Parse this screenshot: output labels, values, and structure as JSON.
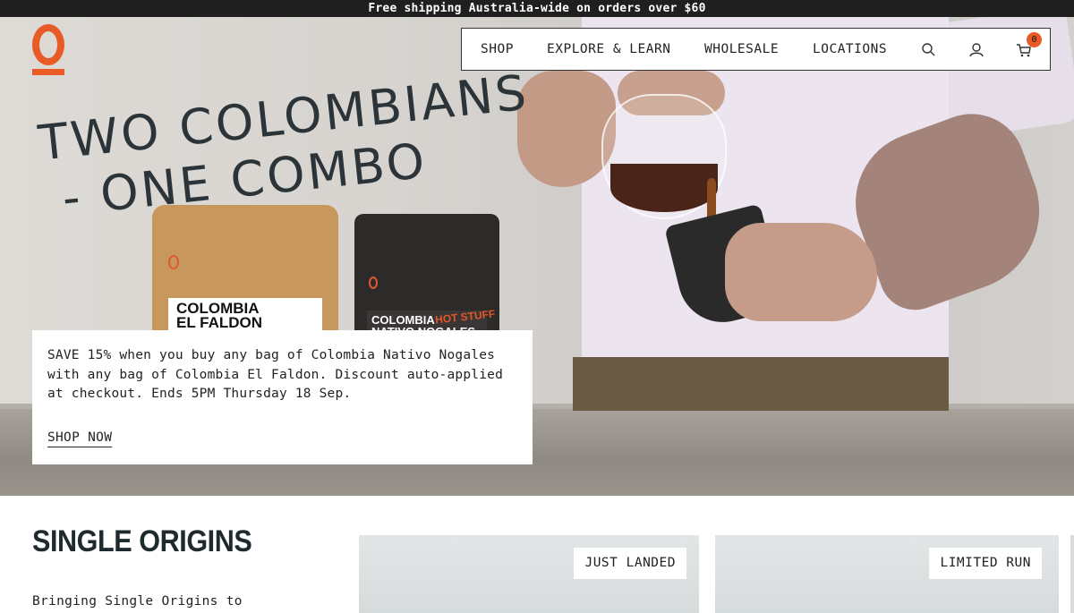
{
  "announcement": {
    "text": "Free shipping Australia-wide on orders over $60"
  },
  "brand": {
    "accent_color": "#e85a26",
    "logo_icon": "brand-logo-icon"
  },
  "nav": {
    "items": [
      {
        "label": "SHOP"
      },
      {
        "label": "EXPLORE & LEARN"
      },
      {
        "label": "WHOLESALE"
      },
      {
        "label": "LOCATIONS"
      }
    ],
    "icons": [
      "search-icon",
      "account-icon",
      "cart-icon"
    ],
    "cart_count": "0"
  },
  "hero": {
    "headline_line1": "TWO COLOMBIANS",
    "headline_line2": "- ONE COMBO",
    "bag1_name": "COLOMBIA EL FALDON",
    "bag2_name": "COLOMBIA NATIVO NOGALES",
    "bag2_tag": "HOT STUFF",
    "promo_text": "SAVE 15% when you buy any bag of Colombia Nativo Nogales with any bag of Colombia El Faldon. Discount auto-applied at checkout. Ends 5PM Thursday 18 Sep.",
    "cta_label": "SHOP NOW"
  },
  "section": {
    "title": "SINGLE ORIGINS",
    "subtitle": "Bringing Single Origins to",
    "cards": [
      {
        "badge": "JUST LANDED"
      },
      {
        "badge": "LIMITED RUN"
      }
    ]
  }
}
